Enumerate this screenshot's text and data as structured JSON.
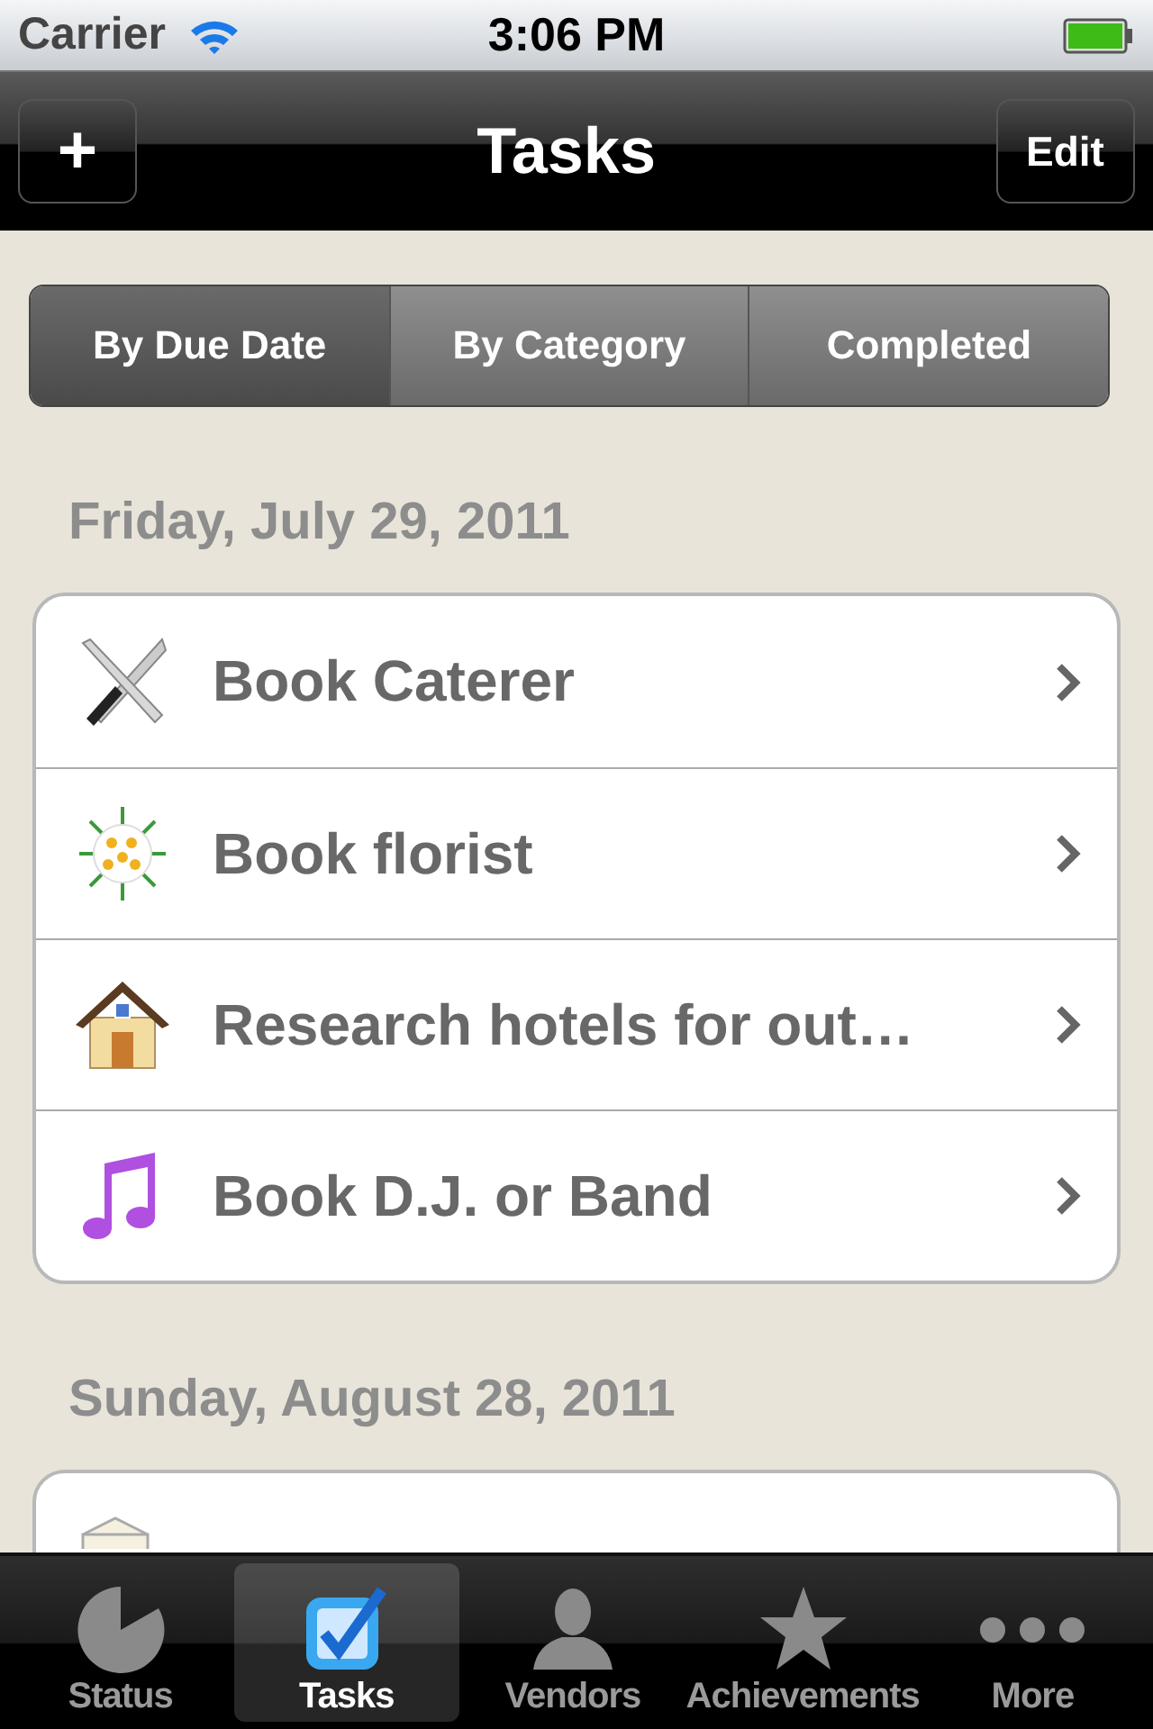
{
  "status_bar": {
    "carrier": "Carrier",
    "time": "3:06 PM"
  },
  "nav_bar": {
    "title": "Tasks",
    "left_button": "+",
    "right_button": "Edit"
  },
  "segments": [
    {
      "label": "By Due Date",
      "selected": true
    },
    {
      "label": "By Category",
      "selected": false
    },
    {
      "label": "Completed",
      "selected": false
    }
  ],
  "sections": [
    {
      "header": "Friday, July 29, 2011",
      "rows": [
        {
          "title": "Book Caterer"
        },
        {
          "title": "Book florist"
        },
        {
          "title": "Research hotels for out…"
        },
        {
          "title": "Book D.J. or Band"
        }
      ]
    },
    {
      "header": "Sunday, August 28, 2011"
    }
  ],
  "tab_bar": [
    {
      "label": "Status",
      "selected": false
    },
    {
      "label": "Tasks",
      "selected": true
    },
    {
      "label": "Vendors",
      "selected": false
    },
    {
      "label": "Achievements",
      "selected": false
    },
    {
      "label": "More",
      "selected": false
    }
  ]
}
